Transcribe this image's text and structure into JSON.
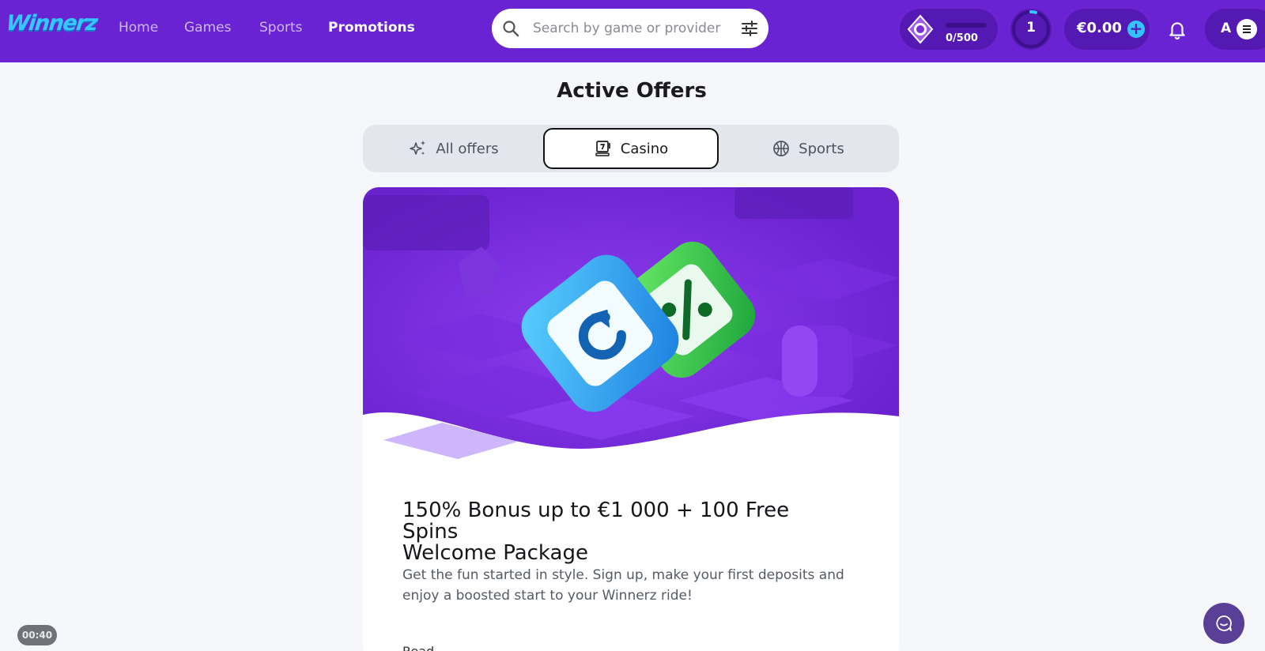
{
  "header": {
    "logo": "Winnerz",
    "nav": [
      {
        "label": "Home",
        "active": false
      },
      {
        "label": "Games",
        "active": false
      },
      {
        "label": "Sports",
        "active": false
      },
      {
        "label": "Promotions",
        "active": true
      }
    ],
    "search": {
      "placeholder": "Search by game or provider",
      "value": ""
    },
    "xp_progress": "0/500",
    "xp_progress_fraction": 0,
    "level": "1",
    "balance": "€0.00",
    "deposit_symbol": "+",
    "avatar_letter": "A"
  },
  "main": {
    "title": "Active Offers",
    "tabs": [
      {
        "label": "All offers",
        "icon": "sparkles-icon",
        "active": false
      },
      {
        "label": "Casino",
        "icon": "slot-machine-icon",
        "active": true
      },
      {
        "label": "Sports",
        "icon": "basketball-icon",
        "active": false
      }
    ],
    "offer": {
      "title_line1": "150% Bonus up to €1 000 + 100 Free Spins",
      "title_line2": "Welcome Package",
      "description_line1": "Get the fun started in style. Sign up, make your first deposits and",
      "description_line2": "enjoy a boosted start to your Winnerz ride!",
      "read_more": "Read"
    }
  },
  "timer": "00:40",
  "colors": {
    "brand": "#6a23d3",
    "brand_dark": "#5519b3",
    "accent": "#33c3ff",
    "background": "#f5f7fa"
  }
}
